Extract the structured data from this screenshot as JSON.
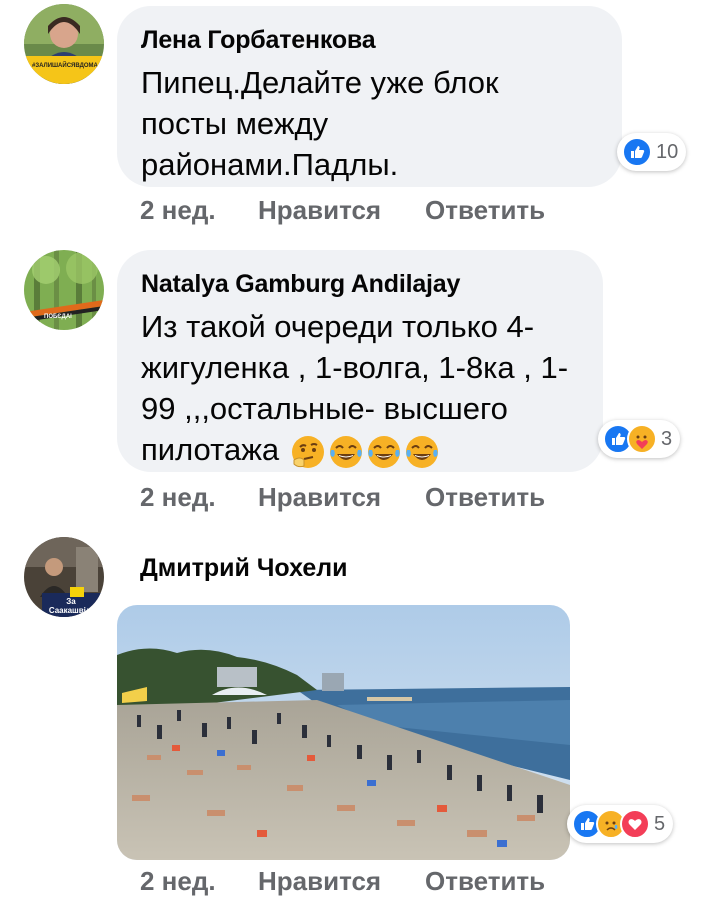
{
  "comments": [
    {
      "author": "Лена Горбатенкова",
      "text": "Пипец.Делайте уже блок посты между районами.Падлы.",
      "time": "2 нед.",
      "like_label": "Нравится",
      "reply_label": "Ответить",
      "reaction_count": "10",
      "reactions": [
        "like"
      ],
      "avatar_badge": "#ЗАЛИШАЙСЯВДОМА"
    },
    {
      "author": "Natalya Gamburg Andilajay",
      "text": "Из такой очереди только 4-жигуленка , 1-волга, 1-8ка , 1-99 ,,,остальные-  высшего пилотажа",
      "time": "2 нед.",
      "like_label": "Нравится",
      "reply_label": "Ответить",
      "reaction_count": "3",
      "reactions": [
        "like",
        "care"
      ],
      "avatar_badge": "ПОБЄДАІ"
    },
    {
      "author": "Дмитрий Чохели",
      "text": "",
      "time": "2 нед.",
      "like_label": "Нравится",
      "reply_label": "Ответить",
      "reaction_count": "5",
      "reactions": [
        "like",
        "sad",
        "love"
      ],
      "avatar_badge": "За Саакашвілі",
      "attachment": "photo"
    }
  ],
  "colors": {
    "bubble": "#f0f2f5",
    "meta_text": "#65676b",
    "like_blue": "#1877f2",
    "love_red": "#f33e58",
    "emoji_yellow": "#f7b125"
  }
}
